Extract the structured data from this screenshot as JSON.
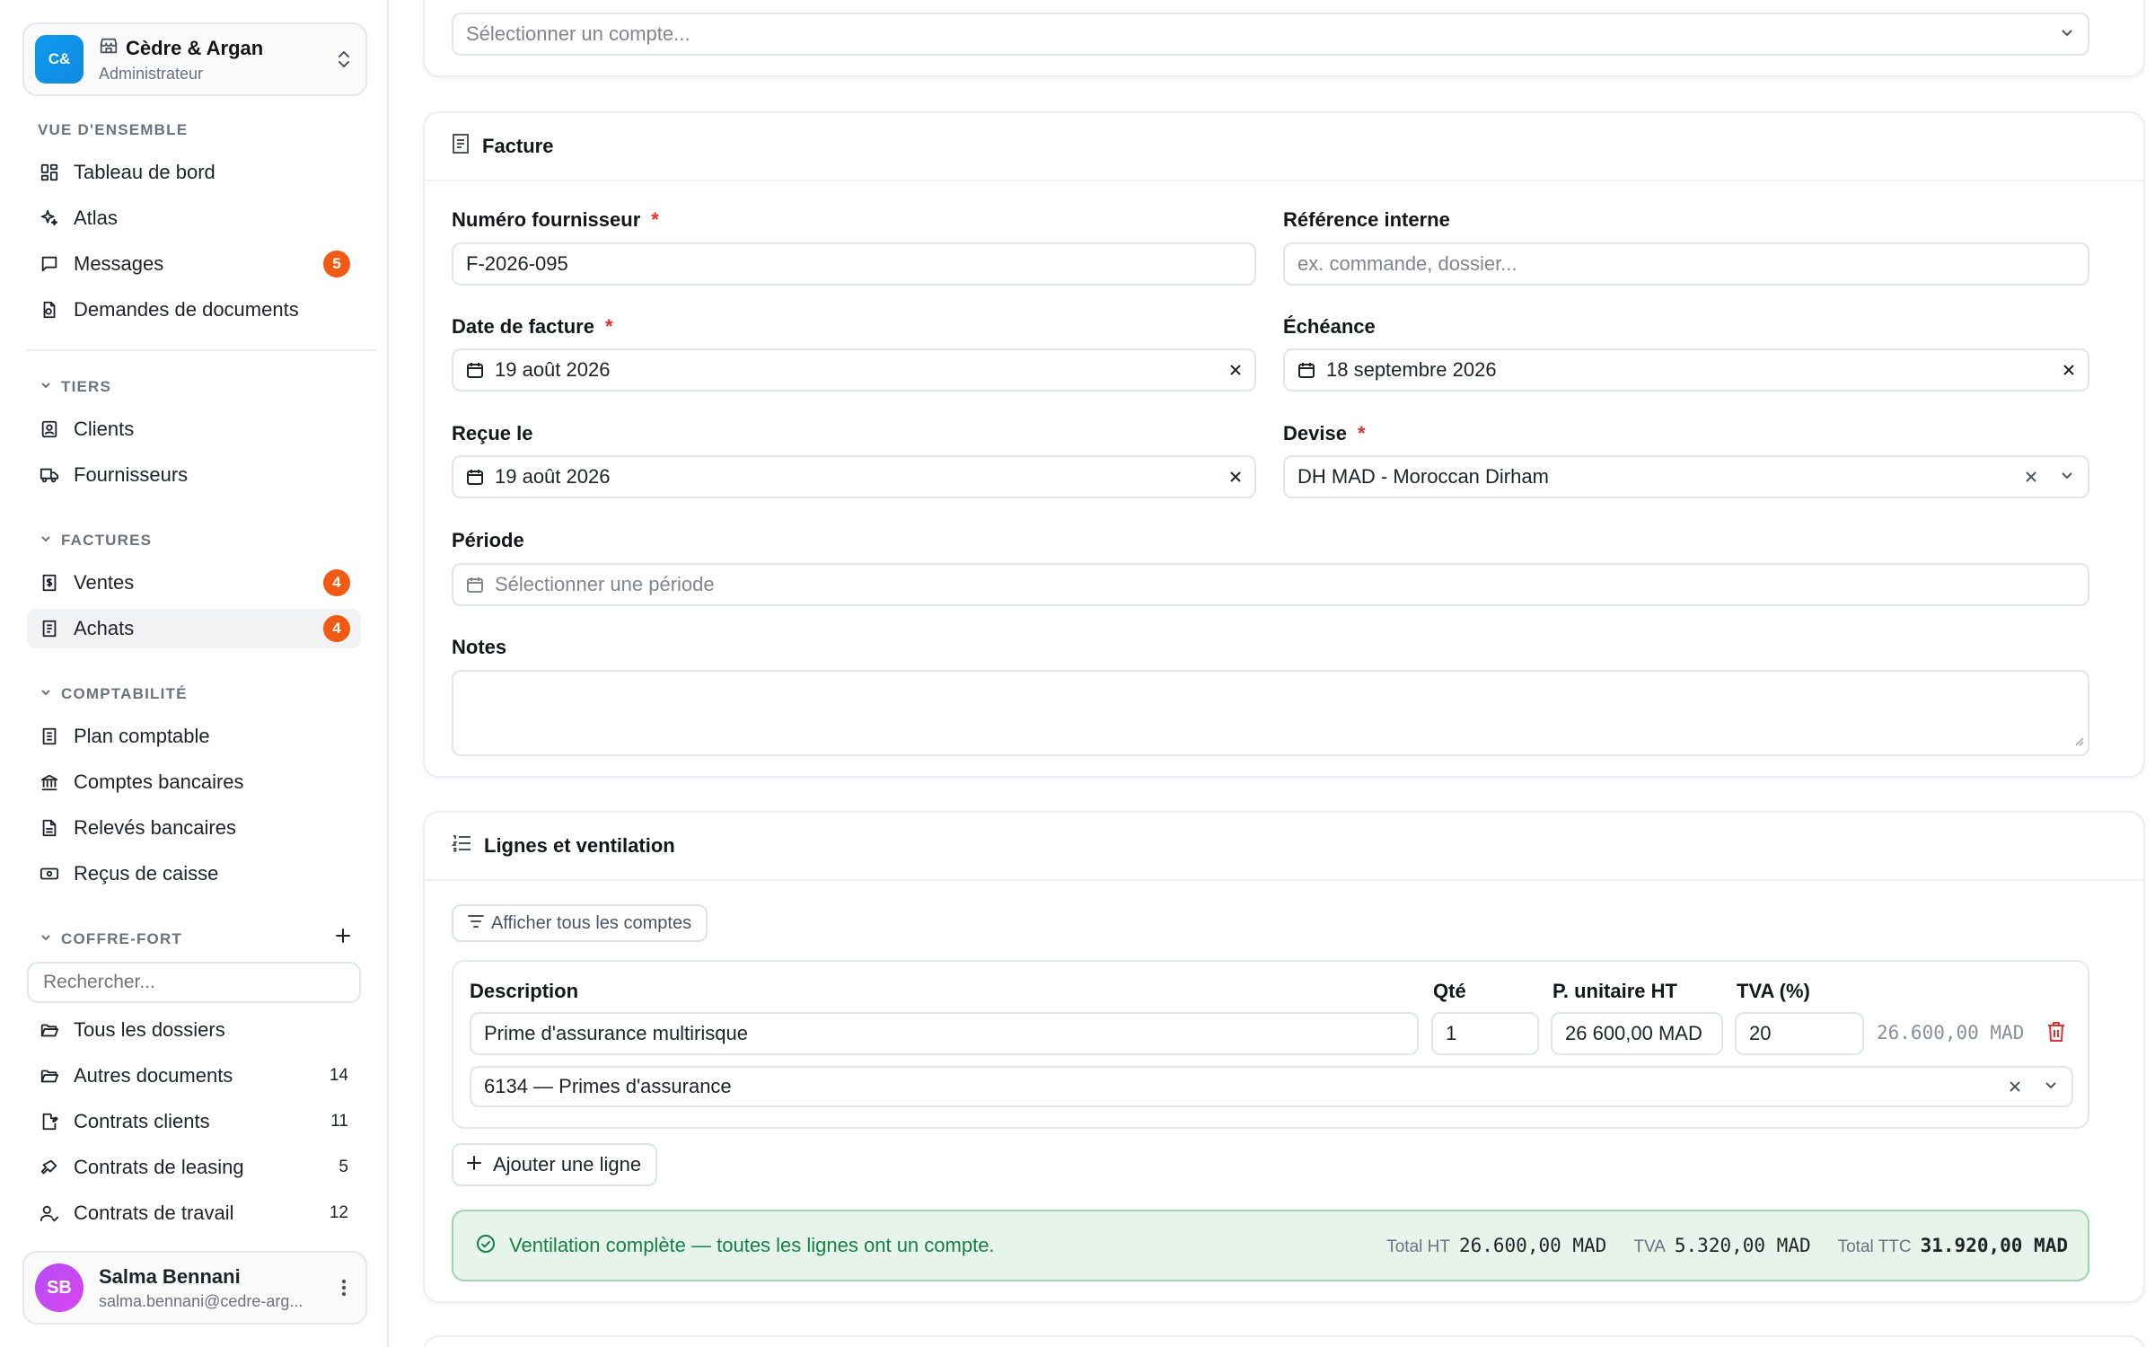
{
  "org": {
    "avatar": "C&",
    "name": "Cèdre & Argan",
    "role": "Administrateur"
  },
  "sidebar": {
    "overview": {
      "title": "VUE D'ENSEMBLE",
      "items": [
        {
          "label": "Tableau de bord",
          "icon": "dashboard-icon"
        },
        {
          "label": "Atlas",
          "icon": "sparkles-icon"
        },
        {
          "label": "Messages",
          "icon": "message-icon",
          "badge": "5"
        },
        {
          "label": "Demandes de documents",
          "icon": "document-request-icon"
        }
      ]
    },
    "tiers": {
      "title": "TIERS",
      "items": [
        {
          "label": "Clients",
          "icon": "contact-icon"
        },
        {
          "label": "Fournisseurs",
          "icon": "truck-icon"
        }
      ]
    },
    "invoices": {
      "title": "FACTURES",
      "items": [
        {
          "label": "Ventes",
          "icon": "receipt-icon",
          "badge": "4"
        },
        {
          "label": "Achats",
          "icon": "document-icon",
          "badge": "4"
        }
      ]
    },
    "accounting": {
      "title": "COMPTABILITÉ",
      "items": [
        {
          "label": "Plan comptable",
          "icon": "ledger-icon"
        },
        {
          "label": "Comptes bancaires",
          "icon": "bank-icon"
        },
        {
          "label": "Relevés bancaires",
          "icon": "statement-icon"
        },
        {
          "label": "Reçus de caisse",
          "icon": "cash-icon"
        }
      ]
    },
    "vault": {
      "title": "COFFRE-FORT",
      "search_placeholder": "Rechercher...",
      "items": [
        {
          "label": "Tous les dossiers",
          "icon": "folder-open-icon"
        },
        {
          "label": "Autres documents",
          "icon": "folder-open-icon",
          "count": "14"
        },
        {
          "label": "Contrats clients",
          "icon": "signature-icon",
          "count": "11"
        },
        {
          "label": "Contrats de leasing",
          "icon": "key-icon",
          "count": "5"
        },
        {
          "label": "Contrats de travail",
          "icon": "user-check-icon",
          "count": "12"
        }
      ]
    }
  },
  "user": {
    "initials": "SB",
    "name": "Salma Bennani",
    "email": "salma.bennani@cedre-arg..."
  },
  "account_select": {
    "placeholder": "Sélectionner un compte..."
  },
  "invoice": {
    "title": "Facture",
    "supplier_number": {
      "label": "Numéro fournisseur",
      "value": "F-2026-095"
    },
    "internal_ref": {
      "label": "Référence interne",
      "placeholder": "ex. commande, dossier..."
    },
    "invoice_date": {
      "label": "Date de facture",
      "value": "19 août 2026"
    },
    "due_date": {
      "label": "Échéance",
      "value": "18 septembre 2026"
    },
    "received": {
      "label": "Reçue le",
      "value": "19 août 2026"
    },
    "currency": {
      "label": "Devise",
      "value": "DH MAD - Moroccan Dirham"
    },
    "period": {
      "label": "Période",
      "placeholder": "Sélectionner une période"
    },
    "notes": {
      "label": "Notes",
      "value": ""
    }
  },
  "lines": {
    "title": "Lignes et ventilation",
    "filter_label": "Afficher tous les comptes",
    "columns": {
      "description": "Description",
      "qty": "Qté",
      "unit_price": "P. unitaire HT",
      "vat": "TVA (%)"
    },
    "rows": [
      {
        "description": "Prime d'assurance multirisque",
        "qty": "1",
        "unit_price": "26 600,00 MAD",
        "vat": "20",
        "total": "26.600,00 MAD",
        "account": "6134 — Primes d'assurance"
      }
    ],
    "add_label": "Ajouter une ligne",
    "status": "Ventilation complète — toutes les lignes ont un compte.",
    "totals": {
      "ht_label": "Total HT",
      "ht": "26.600,00 MAD",
      "tva_label": "TVA",
      "tva": "5.320,00 MAD",
      "ttc_label": "Total TTC",
      "ttc": "31.920,00 MAD"
    }
  },
  "colors": {
    "accent_badge": "#f05a14",
    "success": "#178046",
    "required": "#e03131"
  }
}
